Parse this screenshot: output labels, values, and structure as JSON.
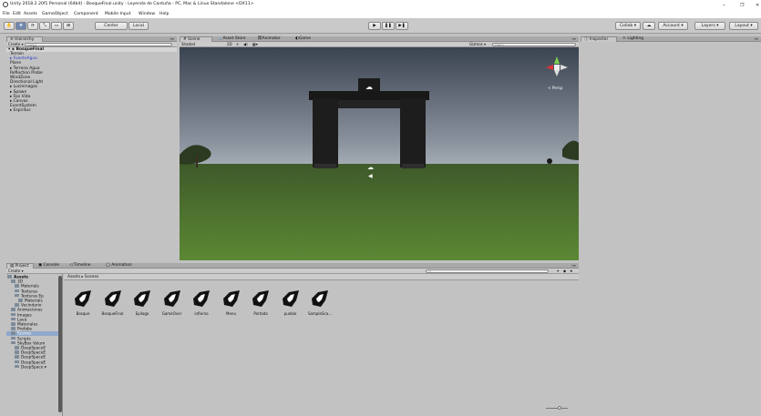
{
  "window": {
    "title": "Unity 2018.2.20f1 Personal (64bit) - BosqueFinal.unity - Leyenda de Cantuña - PC, Mac & Linux Standalone <DX11>",
    "min": "–",
    "max": "❐",
    "close": "✕"
  },
  "menu": [
    "File",
    "Edit",
    "Assets",
    "GameObject",
    "Component",
    "Mobile Input",
    "Window",
    "Help"
  ],
  "toolbar": {
    "pivot": "Center",
    "space": "Local",
    "collab": "Collab ▾",
    "account": "Account ▾",
    "layers": "Layers ▾",
    "layout": "Layout ▾"
  },
  "hierarchy": {
    "tab": "Hierarchy",
    "create": "Create ▾",
    "search_placeholder": "Q▾All",
    "scene": "BosqueFinal",
    "items": [
      "Terrain",
      "FuenteAgua",
      "Plane",
      "Terreno Agua",
      "Reflection Probe",
      "WindZone",
      "Directional Light",
      "Luciernagas",
      "Spawn",
      "Fps Vida",
      "Canvas",
      "EventSystem",
      "Espiritus"
    ],
    "expandable": [
      false,
      true,
      false,
      true,
      false,
      false,
      false,
      true,
      true,
      true,
      true,
      false,
      true
    ]
  },
  "center_tabs": [
    "Scene",
    "Asset Store",
    "Animator",
    "Game"
  ],
  "scene_toolbar": {
    "shading": "Shaded",
    "mode2d": "2D",
    "gizmos": "Gizmos ▾",
    "search_placeholder": "Q▾All",
    "persp": "< Persp"
  },
  "right_tabs": [
    "Inspector",
    "Lighting"
  ],
  "bottom_tabs": [
    "Project",
    "Console",
    "Timeline",
    "Animation"
  ],
  "project": {
    "create": "Create ▾",
    "breadcrumb": "Assets ▸ Scenes",
    "tree": [
      {
        "label": "Assets",
        "depth": 0,
        "bold": true
      },
      {
        "label": "3D",
        "depth": 1
      },
      {
        "label": "Materials",
        "depth": 2
      },
      {
        "label": "Texturas",
        "depth": 2
      },
      {
        "label": "Texturas Ep",
        "depth": 2
      },
      {
        "label": "Materials",
        "depth": 3
      },
      {
        "label": "Vecindario",
        "depth": 2
      },
      {
        "label": "Animaciones",
        "depth": 1
      },
      {
        "label": "Images",
        "depth": 1
      },
      {
        "label": "Lava",
        "depth": 1
      },
      {
        "label": "Materiales",
        "depth": 1
      },
      {
        "label": "Prefabs",
        "depth": 1
      },
      {
        "label": "Scenes",
        "depth": 1
      },
      {
        "label": "Scripts",
        "depth": 1
      },
      {
        "label": "SkyBox Volum",
        "depth": 1
      },
      {
        "label": "DeepSpaceE",
        "depth": 2
      },
      {
        "label": "DeepSpaceE",
        "depth": 2
      },
      {
        "label": "DeepSpaceE",
        "depth": 2
      },
      {
        "label": "DeepSpaceE",
        "depth": 2
      },
      {
        "label": "DeepSpace ▾",
        "depth": 2
      }
    ],
    "selected": "Scenes",
    "assets": [
      "Bosque",
      "BosqueFinal",
      "Epilogo",
      "GameOver",
      "infierno",
      "Menu",
      "Portada",
      "pueblo",
      "SampleSca..."
    ]
  }
}
